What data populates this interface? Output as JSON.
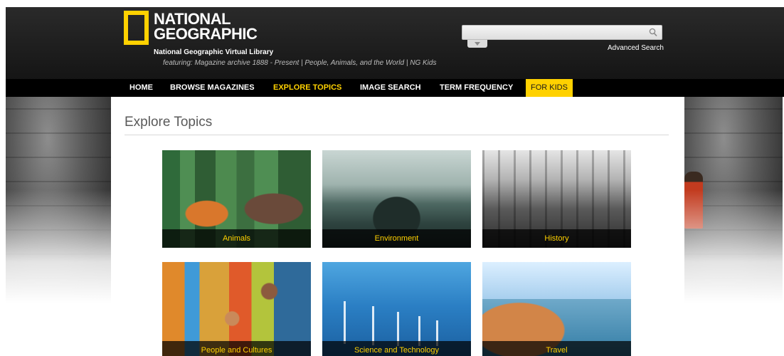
{
  "header": {
    "logo_line1": "NATIONAL",
    "logo_line2": "GEOGRAPHIC",
    "library_title": "National Geographic Virtual Library",
    "featuring": "featuring: Magazine archive 1888 - Present | People, Animals, and the World | NG Kids",
    "search": {
      "value": "",
      "placeholder": ""
    },
    "advanced_search": "Advanced Search"
  },
  "nav": {
    "items": [
      {
        "label": "HOME"
      },
      {
        "label": "BROWSE MAGAZINES"
      },
      {
        "label": "EXPLORE TOPICS",
        "active": true
      },
      {
        "label": "IMAGE SEARCH"
      },
      {
        "label": "TERM FREQUENCY"
      },
      {
        "label": "FOR KIDS"
      }
    ]
  },
  "main": {
    "title": "Explore Topics",
    "topics": [
      {
        "label": "Animals"
      },
      {
        "label": "Environment"
      },
      {
        "label": "History"
      },
      {
        "label": "People and Cultures"
      },
      {
        "label": "Science and Technology"
      },
      {
        "label": "Travel"
      }
    ]
  },
  "colors": {
    "accent": "#ffd100",
    "header_bg": "#1a1a1a",
    "nav_bg": "#000000"
  }
}
